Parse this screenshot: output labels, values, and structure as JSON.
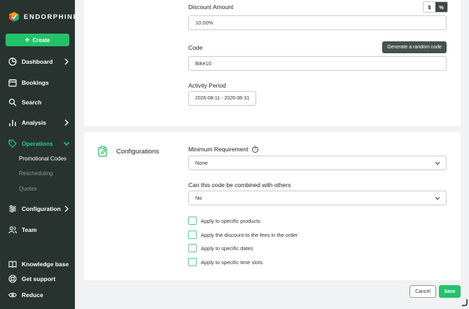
{
  "sidebar": {
    "brand": "ENDORPHINE",
    "create_label": "Create",
    "items": {
      "dashboard": "Dashboard",
      "bookings": "Bookings",
      "search": "Search",
      "analysis": "Analysis",
      "operations": "Operations",
      "configuration": "Configuration",
      "team": "Team",
      "knowledge_base": "Knowledge base",
      "get_support": "Get support",
      "reduce": "Reduce"
    },
    "operations_sub": {
      "promotional_codes": "Promotional Codes",
      "rescheduling": "Rescheduling",
      "quotes": "Quotes"
    },
    "colors": {
      "background": "#28332f",
      "accent": "#23c26a",
      "active_text": "#2fd07c"
    }
  },
  "discount": {
    "label": "Discount Amount",
    "value": "10.00%",
    "toggle": {
      "dollar": "$",
      "percent": "%",
      "selected": "%"
    }
  },
  "code": {
    "label": "Code",
    "value": "Bike10",
    "generate_label": "Generate a random code"
  },
  "activity": {
    "label": "Activity Period",
    "value": "2026-08-11 - 2026-08-31"
  },
  "configurations": {
    "title": "Configurations",
    "min_requirement_label": "Minimum Requirement",
    "min_requirement_value": "None",
    "combine_label": "Can this code be combined with others",
    "combine_value": "No",
    "checkboxes": [
      "Apply to specific products",
      "Apply the discount to the fees in the order",
      "Apply to specific dates",
      "Apply to specific time slots"
    ]
  },
  "footer": {
    "cancel_label": "Cancel",
    "save_label": "Save"
  }
}
